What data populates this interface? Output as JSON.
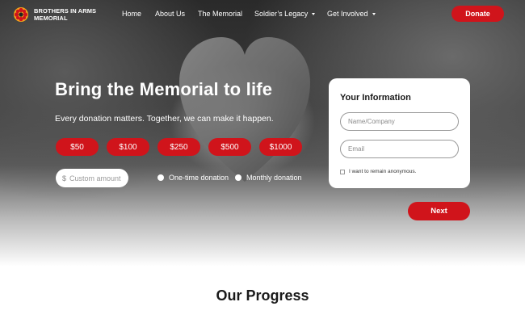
{
  "brand": {
    "line1": "BROTHERS IN ARMS",
    "line2": "MEMORIAL",
    "accent": "#d0141b",
    "logo_color": "#f2a31b"
  },
  "nav": {
    "items": [
      {
        "label": "Home",
        "dropdown": false
      },
      {
        "label": "About Us",
        "dropdown": false
      },
      {
        "label": "The Memorial",
        "dropdown": false
      },
      {
        "label": "Soldier’s Legacy",
        "dropdown": true
      },
      {
        "label": "Get Involved",
        "dropdown": true
      }
    ],
    "donate_label": "Donate"
  },
  "hero": {
    "headline": "Bring the Memorial to life",
    "subline": "Every donation matters. Together, we can make it happen.",
    "amounts": [
      "$50",
      "$100",
      "$250",
      "$500",
      "$1000"
    ],
    "custom": {
      "currency": "$",
      "placeholder": "Custom amount"
    },
    "frequency": [
      "One-time donation",
      "Monthly donation"
    ]
  },
  "form": {
    "title": "Your Information",
    "name_placeholder": "Name/Company",
    "email_placeholder": "Email",
    "anonymous_label": "I want to remain anonymous.",
    "next_label": "Next"
  },
  "progress": {
    "title": "Our Progress"
  }
}
